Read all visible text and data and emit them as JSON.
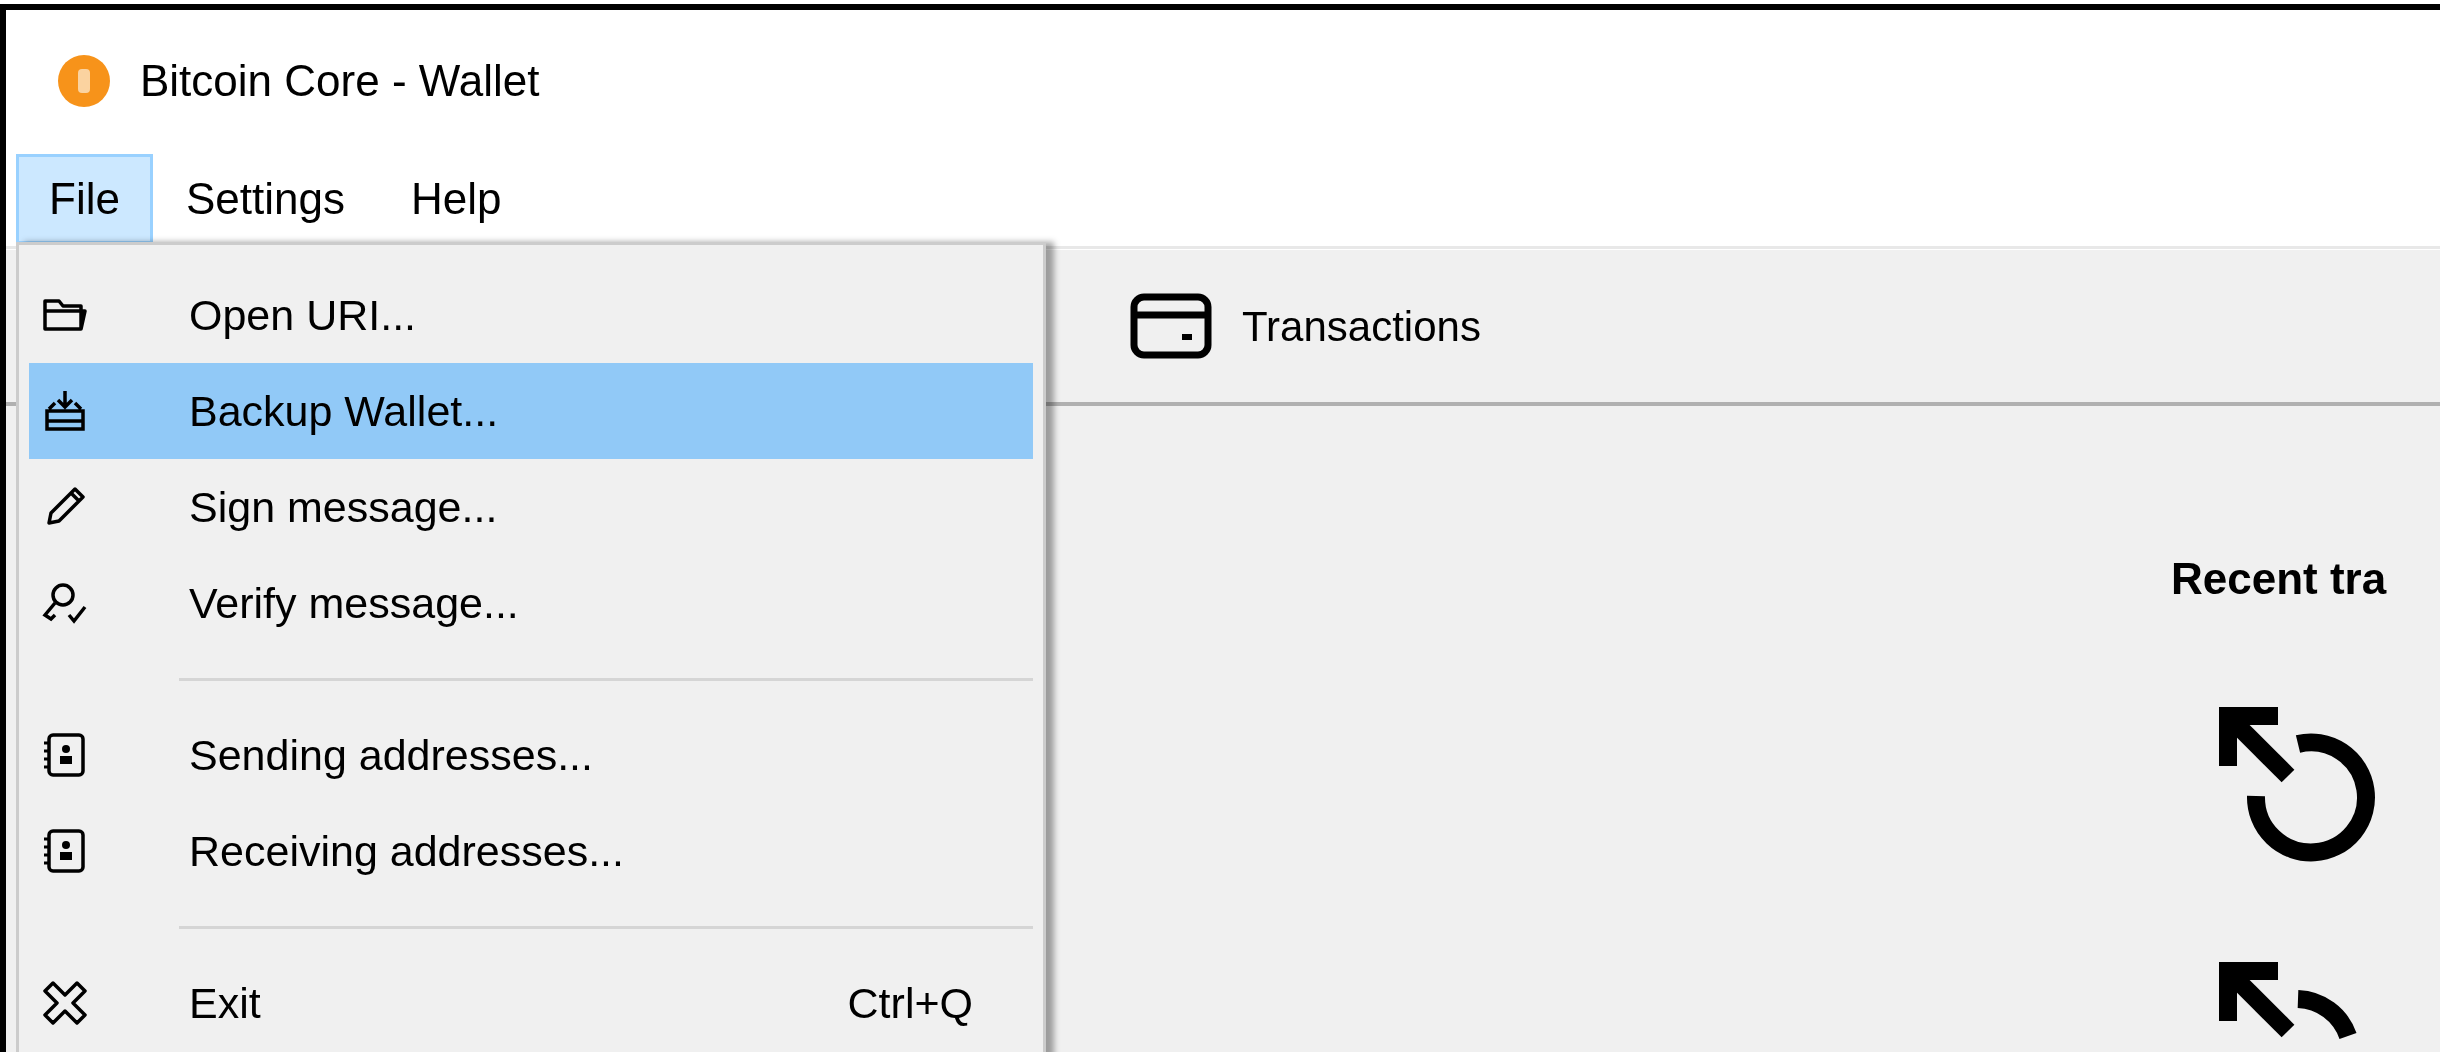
{
  "window": {
    "title": "Bitcoin Core - Wallet"
  },
  "menu_bar": [
    {
      "label": "File",
      "selected": true
    },
    {
      "label": "Settings",
      "selected": false
    },
    {
      "label": "Help",
      "selected": false
    }
  ],
  "file_menu": [
    {
      "kind": "item",
      "label": "Open URI...",
      "selected": false
    },
    {
      "kind": "item",
      "label": "Backup Wallet...",
      "selected": true
    },
    {
      "kind": "item",
      "label": "Sign message...",
      "selected": false
    },
    {
      "kind": "item",
      "label": "Verify message...",
      "selected": false
    },
    {
      "kind": "separator"
    },
    {
      "kind": "item",
      "label": "Sending addresses...",
      "selected": false
    },
    {
      "kind": "item",
      "label": "Receiving addresses...",
      "selected": false
    },
    {
      "kind": "separator"
    },
    {
      "kind": "item",
      "label": "Exit",
      "shortcut": "Ctrl+Q",
      "selected": false
    }
  ],
  "toolbar": [
    {
      "label": "Transactions"
    }
  ],
  "recent_transactions": {
    "heading": "Recent tra"
  }
}
